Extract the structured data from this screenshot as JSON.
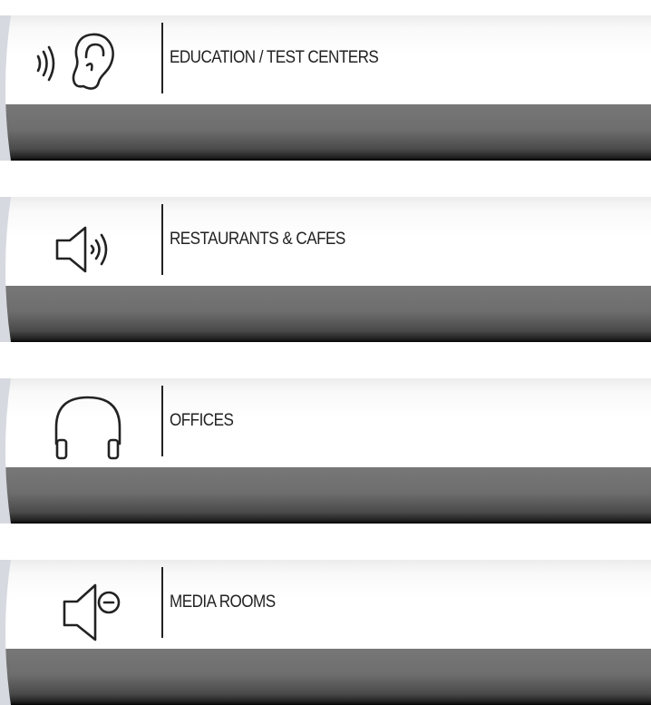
{
  "items": [
    {
      "label": "EDUCATION / TEST CENTERS",
      "icon": "ear-sound-icon"
    },
    {
      "label": "RESTAURANTS & CAFES",
      "icon": "speaker-sound-icon"
    },
    {
      "label": "OFFICES",
      "icon": "headphones-icon"
    },
    {
      "label": "MEDIA ROOMS",
      "icon": "speaker-minus-icon"
    }
  ],
  "colors": {
    "panel_light": "#ffffff",
    "panel_dark": "#6e6e6e",
    "text": "#222222"
  }
}
